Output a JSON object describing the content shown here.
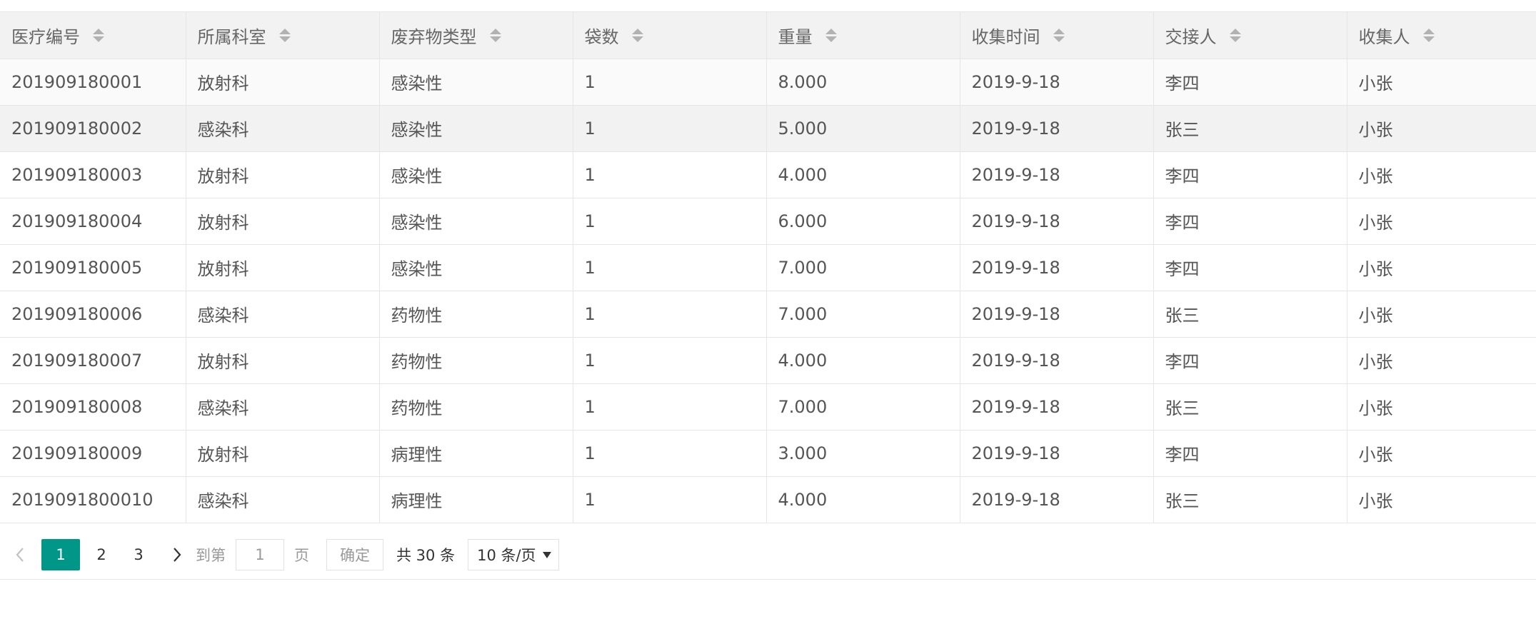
{
  "table": {
    "columns": [
      "医疗编号",
      "所属科室",
      "废弃物类型",
      "袋数",
      "重量",
      "收集时间",
      "交接人",
      "收集人"
    ],
    "rows": [
      [
        "201909180001",
        "放射科",
        "感染性",
        "1",
        "8.000",
        "2019-9-18",
        "李四",
        "小张"
      ],
      [
        "201909180002",
        "感染科",
        "感染性",
        "1",
        "5.000",
        "2019-9-18",
        "张三",
        "小张"
      ],
      [
        "201909180003",
        "放射科",
        "感染性",
        "1",
        "4.000",
        "2019-9-18",
        "李四",
        "小张"
      ],
      [
        "201909180004",
        "放射科",
        "感染性",
        "1",
        "6.000",
        "2019-9-18",
        "李四",
        "小张"
      ],
      [
        "201909180005",
        "放射科",
        "感染性",
        "1",
        "7.000",
        "2019-9-18",
        "李四",
        "小张"
      ],
      [
        "201909180006",
        "感染科",
        "药物性",
        "1",
        "7.000",
        "2019-9-18",
        "张三",
        "小张"
      ],
      [
        "201909180007",
        "放射科",
        "药物性",
        "1",
        "4.000",
        "2019-9-18",
        "李四",
        "小张"
      ],
      [
        "201909180008",
        "感染科",
        "药物性",
        "1",
        "7.000",
        "2019-9-18",
        "张三",
        "小张"
      ],
      [
        "201909180009",
        "放射科",
        "病理性",
        "1",
        "3.000",
        "2019-9-18",
        "李四",
        "小张"
      ],
      [
        "2019091800010",
        "感染科",
        "病理性",
        "1",
        "4.000",
        "2019-9-18",
        "张三",
        "小张"
      ]
    ]
  },
  "pagination": {
    "pages": [
      "1",
      "2",
      "3"
    ],
    "current_page": "1",
    "goto_label": "到第",
    "goto_value": "1",
    "page_label": "页",
    "confirm_label": "确定",
    "total_label": "共 30 条",
    "page_size_label": "10 条/页"
  },
  "colors": {
    "accent": "#009688",
    "header_bg": "#f2f2f2",
    "border": "#e6e6e6"
  }
}
